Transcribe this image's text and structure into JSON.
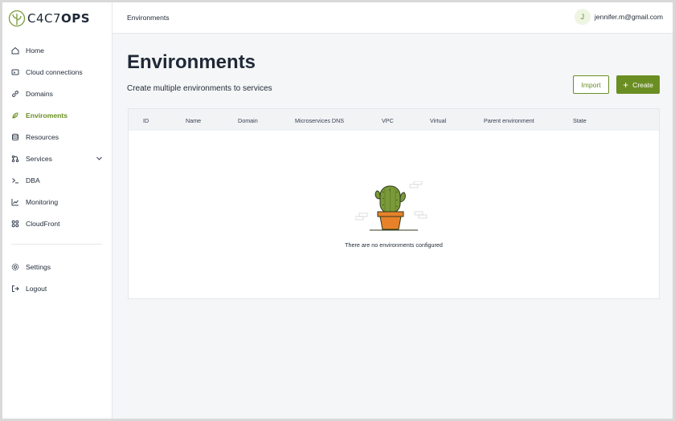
{
  "brand": {
    "logo_text_light": "C4C7",
    "logo_text_bold": "OPS"
  },
  "sidebar": {
    "items": [
      {
        "label": "Home",
        "icon": "home-icon"
      },
      {
        "label": "Cloud connections",
        "icon": "cloud-connections-icon"
      },
      {
        "label": "Domains",
        "icon": "link-icon"
      },
      {
        "label": "Enviroments",
        "icon": "environments-icon",
        "active": true
      },
      {
        "label": "Resources",
        "icon": "database-icon"
      },
      {
        "label": "Services",
        "icon": "services-icon",
        "has_submenu": true
      },
      {
        "label": "DBA",
        "icon": "terminal-icon"
      },
      {
        "label": "Monitoring",
        "icon": "chart-icon"
      },
      {
        "label": "CloudFront",
        "icon": "grid-icon"
      }
    ],
    "bottom_items": [
      {
        "label": "Settings",
        "icon": "gear-icon"
      },
      {
        "label": "Logout",
        "icon": "logout-icon"
      }
    ]
  },
  "header": {
    "breadcrumb": "Environments",
    "user": {
      "initial": "J",
      "email": "jennifer.m@gmail.com"
    }
  },
  "main": {
    "title": "Environments",
    "subtitle": "Create multiple environments to services",
    "import_label": "Import",
    "create_label": "Create",
    "table": {
      "columns": [
        "ID",
        "Name",
        "Domain",
        "Microservices DNS",
        "VPC",
        "Virtual",
        "Parent environment",
        "State"
      ],
      "rows": [],
      "empty_message": "There are no environments configured"
    }
  },
  "colors": {
    "accent": "#6b8e23",
    "background": "#f5f6f7",
    "cactus": "#7a9a3a",
    "pot": "#e8822a"
  }
}
